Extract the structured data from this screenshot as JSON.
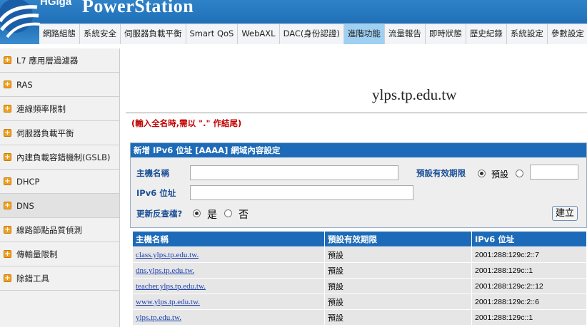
{
  "header": {
    "brand_small": "HGiga",
    "brand_big": "PowerStation",
    "nav": [
      {
        "label": "網路組態",
        "active": false
      },
      {
        "label": "系統安全",
        "active": false
      },
      {
        "label": "伺服器負載平衡",
        "active": false
      },
      {
        "label": "Smart QoS",
        "active": false
      },
      {
        "label": "WebAXL",
        "active": false
      },
      {
        "label": "DAC(身份認證)",
        "active": false
      },
      {
        "label": "進階功能",
        "active": true
      },
      {
        "label": "流量報告",
        "active": false
      },
      {
        "label": "即時狀態",
        "active": false
      },
      {
        "label": "歷史紀錄",
        "active": false
      },
      {
        "label": "系統設定",
        "active": false
      },
      {
        "label": "參數設定",
        "active": false
      }
    ]
  },
  "sidebar": {
    "items": [
      {
        "label": "L7 應用層過濾器",
        "active": false
      },
      {
        "label": "RAS",
        "active": false
      },
      {
        "label": "連線頻率限制",
        "active": false
      },
      {
        "label": "伺服器負載平衡",
        "active": false
      },
      {
        "label": "內建負載容錯機制(GSLB)",
        "active": false
      },
      {
        "label": "DHCP",
        "active": false
      },
      {
        "label": "DNS",
        "active": true
      },
      {
        "label": "線路節點品質偵測",
        "active": false
      },
      {
        "label": "傳輸量限制",
        "active": false
      },
      {
        "label": "除錯工具",
        "active": false
      }
    ]
  },
  "main": {
    "domain": "ylps.tp.edu.tw",
    "note": "(輸入全名時,需以 \".\" 作結尾)",
    "form": {
      "title": "新增 IPv6 位址 [AAAA] 網域內容設定",
      "host_label": "主機名稱",
      "host_value": "",
      "ttl_label": "預設有效期限",
      "ttl_default_label": "預設",
      "ttl_default_checked": true,
      "ttl_custom_value": "",
      "ipv6_label": "IPv6 位址",
      "ipv6_value": "",
      "reverse_label": "更新反查檔?",
      "reverse_yes": "是",
      "reverse_no": "否",
      "reverse_yes_checked": true,
      "create_label": "建立"
    },
    "table": {
      "columns": [
        "主機名稱",
        "預設有效期限",
        "IPv6 位址"
      ],
      "rows": [
        {
          "host": "class.ylps.tp.edu.tw.",
          "ttl": "預設",
          "ipv6": "2001:288:129c:2::7"
        },
        {
          "host": "dns.ylps.tp.edu.tw.",
          "ttl": "預設",
          "ipv6": "2001:288:129c::1"
        },
        {
          "host": "teacher.ylps.tp.edu.tw.",
          "ttl": "預設",
          "ipv6": "2001:288:129c:2::12"
        },
        {
          "host": "www.ylps.tp.edu.tw.",
          "ttl": "預設",
          "ipv6": "2001:288:129c:2::6"
        },
        {
          "host": "ylps.tp.edu.tw.",
          "ttl": "預設",
          "ipv6": "2001:288:129c::1"
        }
      ]
    }
  }
}
